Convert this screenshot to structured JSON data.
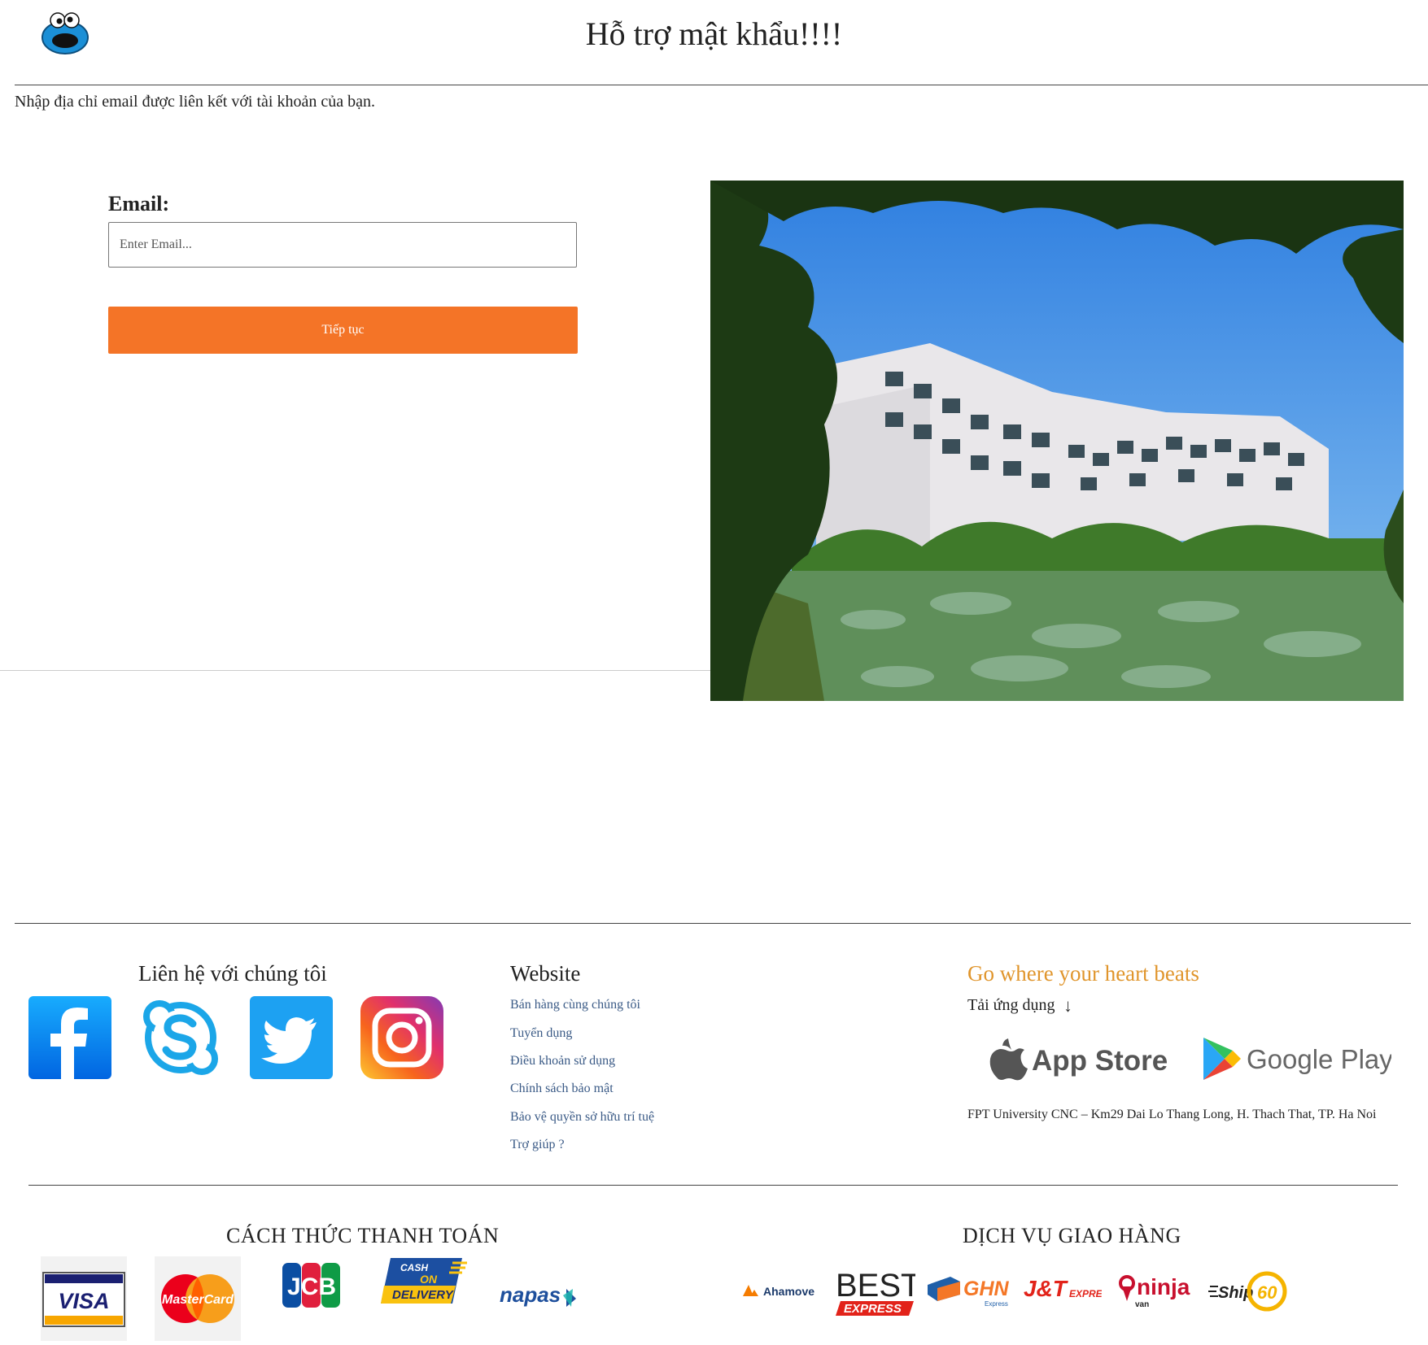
{
  "header": {
    "title": "Hỗ trợ mật khẩu!!!!",
    "instruction": "Nhập địa chỉ email được liên kết với tài khoản của bạn."
  },
  "form": {
    "email_label": "Email:",
    "email_placeholder": "Enter Email...",
    "email_value": "",
    "submit_label": "Tiếp tục"
  },
  "footer": {
    "contact": {
      "heading": "Liên hệ với chúng tôi",
      "socials": [
        "facebook-icon",
        "skype-icon",
        "twitter-icon",
        "instagram-icon"
      ]
    },
    "website": {
      "heading": "Website",
      "links": [
        "Bán hàng cùng chúng tôi",
        "Tuyển dụng",
        "Điều khoản sử dụng",
        "Chính sách bảo mật",
        "Bảo vệ quyền sở hữu trí tuệ",
        "Trợ giúp ?"
      ]
    },
    "app": {
      "slogan": "Go where your heart beats",
      "download_label": "Tải ứng dụng",
      "app_store": "App Store",
      "google_play": "Google Play",
      "address": "FPT University CNC – Km29 Dai Lo Thang Long, H. Thach That, TP. Ha Noi"
    },
    "payment": {
      "heading": "CÁCH THỨC THANH TOÁN",
      "methods": [
        "VISA",
        "MasterCard",
        "JCB",
        "CASH",
        "ON",
        "DELIVERY",
        "napas"
      ]
    },
    "shipping": {
      "heading": "DỊCH VỤ GIAO HÀNG",
      "providers": [
        "Ahamove",
        "BEST",
        "EXPRESS",
        "GHN",
        "Express",
        "J&T",
        "EXPRESS",
        "ninja",
        "van",
        "Ship",
        "60"
      ]
    }
  },
  "colors": {
    "accent_orange": "#f47427",
    "slogan_gold": "#e0952c",
    "link_blue": "#3a5a86"
  }
}
